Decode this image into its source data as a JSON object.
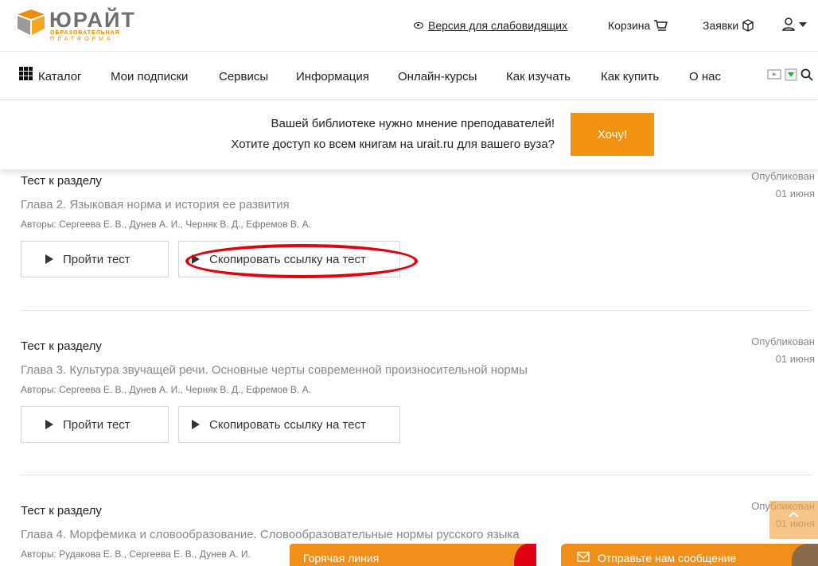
{
  "header": {
    "logo_title": "ЮРАЙТ",
    "logo_sub1": "ОБРАЗОВАТЕЛЬНАЯ",
    "logo_sub2": "ПЛАТФОРМА",
    "vision_link": "Версия для слабовидящих",
    "cart": "Корзина",
    "orders": "Заявки"
  },
  "nav": {
    "items": [
      "Каталог",
      "Мои подписки",
      "Сервисы",
      "Информация",
      "Онлайн-курсы",
      "Как изучать",
      "Как купить",
      "О нас"
    ]
  },
  "banner": {
    "line1": "Вашей библиотеке нужно мнение преподавателей!",
    "line2": "Хотите доступ ко всем книгам на urait.ru для вашего вуза?",
    "button": "Хочу!"
  },
  "tests": [
    {
      "label": "Тест к разделу",
      "chapter": "Глава 2. Языковая норма и история ее развития",
      "authors": "Авторы: Сергеева Е. В., Дунев А. И., Черняк В. Д., Ефремов В. А.",
      "published": "Опубликован",
      "date": "01 июня",
      "take_test": "Пройти тест",
      "copy_link": "Скопировать ссылку на тест"
    },
    {
      "label": "Тест к разделу",
      "chapter": "Глава 3. Культура звучащей речи. Основные черты современной произносительной нормы",
      "authors": "Авторы: Сергеева Е. В., Дунев А. И., Черняк В. Д., Ефремов В. А.",
      "published": "Опубликован",
      "date": "01 июня",
      "take_test": "Пройти тест",
      "copy_link": "Скопировать ссылку на тест"
    },
    {
      "label": "Тест к разделу",
      "chapter": "Глава 4. Морфемика и словообразование. Словообразовательные нормы русского языка",
      "authors": "Авторы: Рудакова Е. В., Сергеева Е. В., Дунев А. И.",
      "published": "Опубликован",
      "date": "01 июня"
    }
  ],
  "widgets": {
    "hotline": "Горячая линия",
    "message": "Отправьте нам сообщение"
  },
  "colors": {
    "accent": "#f39110",
    "annotation": "#e5000c"
  }
}
